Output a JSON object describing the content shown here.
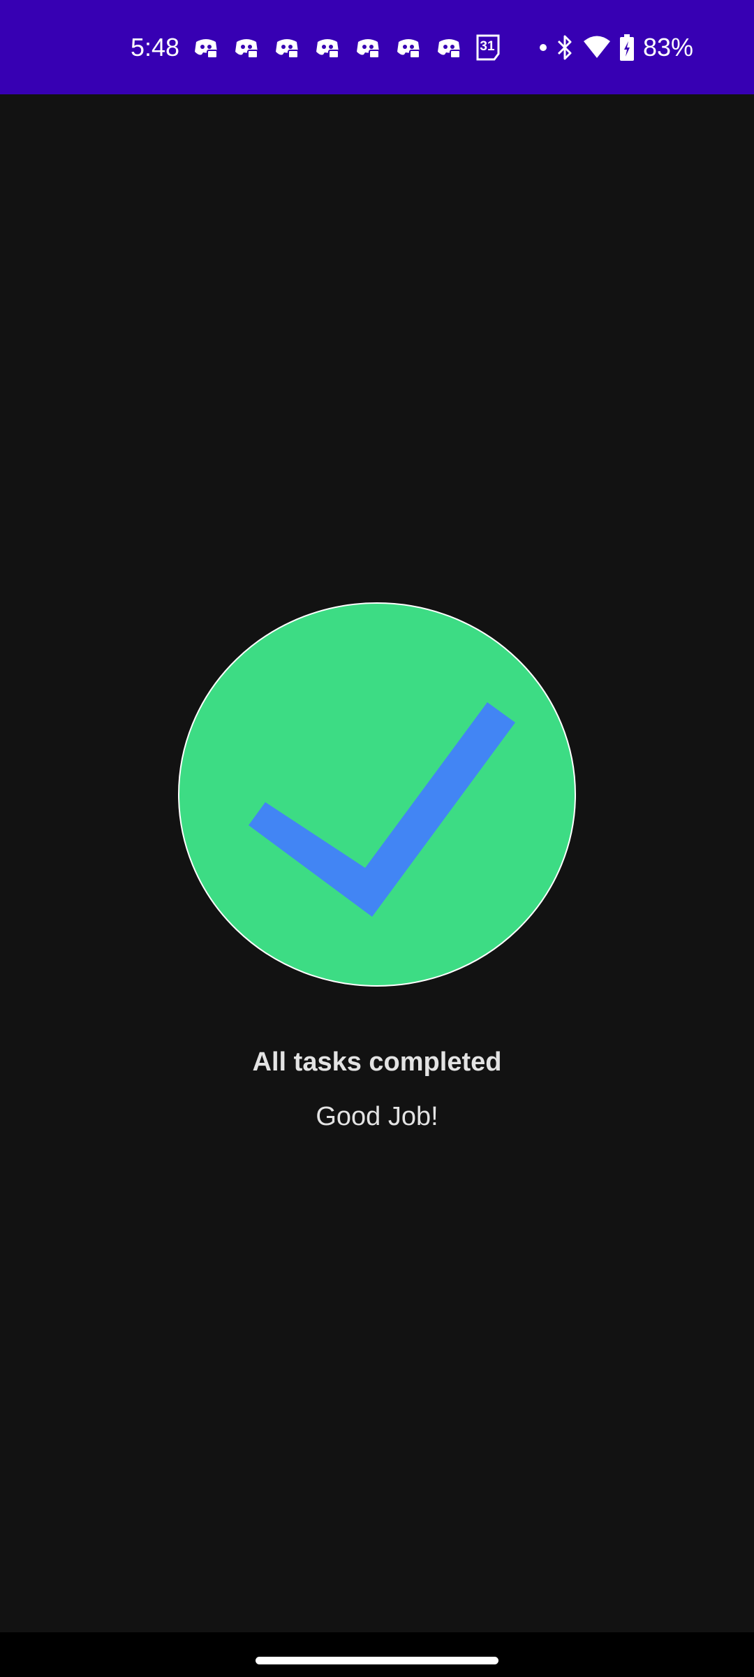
{
  "status_bar": {
    "time": "5:48",
    "notification_icons": [
      "discord-icon",
      "discord-icon",
      "discord-icon",
      "discord-icon",
      "discord-icon",
      "discord-icon",
      "discord-icon"
    ],
    "calendar_day": "31",
    "battery_percent": "83%",
    "background_color": "#3700B3"
  },
  "main": {
    "title": "All tasks completed",
    "subtitle": "Good Job!",
    "icon": "check-circle-icon",
    "circle_color": "#3DDC84",
    "check_color": "#4285F4"
  }
}
